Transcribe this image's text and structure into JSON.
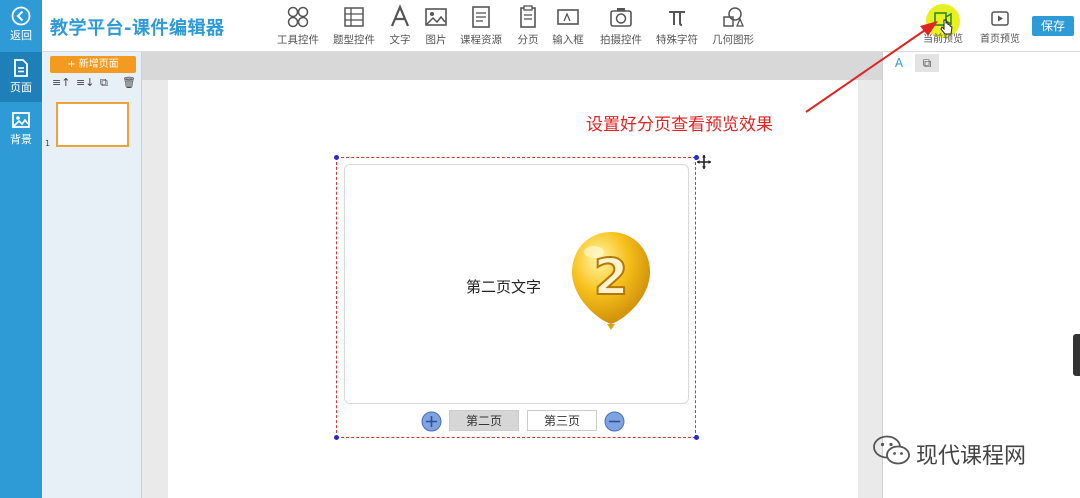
{
  "rail": {
    "back_label": "返回",
    "pages_label": "页面",
    "background_label": "背景"
  },
  "header": {
    "title": "教学平台-课件编辑器",
    "tools": [
      {
        "label": "工具控件",
        "icon": "widgets-icon"
      },
      {
        "label": "题型控件",
        "icon": "question-type-icon"
      },
      {
        "label": "文字",
        "icon": "text-icon"
      },
      {
        "label": "图片",
        "icon": "image-icon"
      },
      {
        "label": "课程资源",
        "icon": "course-resource-icon"
      },
      {
        "label": "分页",
        "icon": "pagination-icon"
      },
      {
        "label": "输入框",
        "icon": "input-box-icon"
      },
      {
        "label": "拍摄控件",
        "icon": "camera-icon"
      },
      {
        "label": "特殊字符",
        "icon": "pi-icon"
      },
      {
        "label": "几何图形",
        "icon": "shapes-icon"
      }
    ],
    "current_preview_label": "当前预览",
    "home_preview_label": "首页预览",
    "save_label": "保存"
  },
  "pages_panel": {
    "add_page_label": "+ 新增页面",
    "thumbnail_number": "1"
  },
  "canvas": {
    "card_text": "第二页文字",
    "balloon_number": "2",
    "pager_tabs": [
      "第二页",
      "第三页"
    ]
  },
  "annotation": {
    "text": "设置好分页查看预览效果"
  },
  "properties": {
    "tab_text": "A"
  },
  "watermark": {
    "text": "现代课程网"
  },
  "colors": {
    "brand": "#2e9bd6",
    "accent_orange": "#f39a21",
    "annotation_red": "#e02424"
  }
}
